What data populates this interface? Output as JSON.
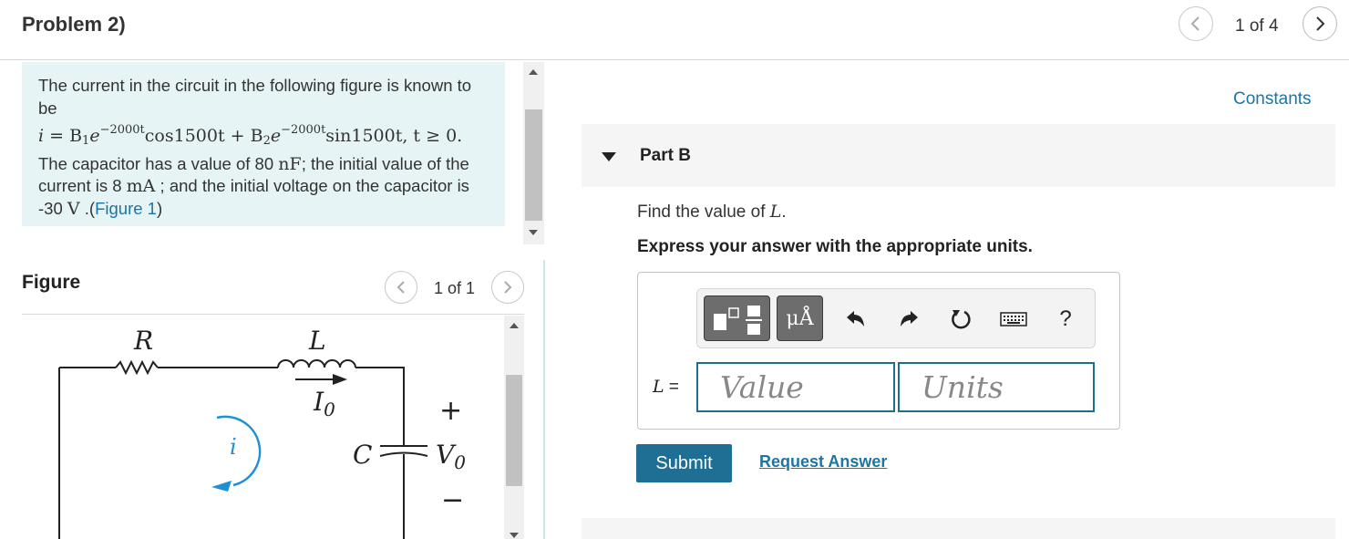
{
  "header": {
    "title": "Problem 2)",
    "pager": "1 of 4"
  },
  "intro": {
    "line1": "The current in the circuit in the following figure is known to be",
    "eq_i": "i",
    "eq_eq": " = B",
    "eq_b1sub": "1",
    "eq_e": "e",
    "eq_exp1": "−2000t",
    "eq_cos": "cos1500t + B",
    "eq_b2sub": "2",
    "eq_e2": "e",
    "eq_exp2": "−2000t",
    "eq_sin": "sin1500t, t ≥ 0.",
    "text2a": "The capacitor has a value of 80 ",
    "unit_nf": "nF",
    "text2b": "; the initial value of the current is 8 ",
    "unit_ma": "mA",
    "text2c": " ; and the initial voltage on the capacitor is -30 ",
    "unit_v": "V",
    "text2d": " .(",
    "figure_link": "Figure 1",
    "text2e": ")"
  },
  "figure": {
    "label": "Figure",
    "pager": "1 of 1",
    "circuit": {
      "R": "R",
      "L": "L",
      "I0_main": "I",
      "I0_sub": "0",
      "i": "i",
      "C": "C",
      "V0_main": "V",
      "V0_sub": "0",
      "plus": "+",
      "minus": "−"
    }
  },
  "right": {
    "constants": "Constants",
    "part_title": "Part B",
    "question_prefix": "Find the value of ",
    "question_var": "L",
    "question_suffix": ".",
    "instruction": "Express your answer with the appropriate units.",
    "lhs_var": "L",
    "lhs_eq": " =",
    "value_placeholder": "Value",
    "units_placeholder": "Units",
    "toolbar_units_label": "μÅ",
    "help_label": "?",
    "submit": "Submit",
    "request_answer": "Request Answer"
  },
  "icons": {
    "prev": "chevron-left-icon",
    "next": "chevron-right-icon",
    "templates": "templates-icon",
    "units": "units-icon",
    "undo": "undo-icon",
    "redo": "redo-icon",
    "reset": "reset-icon",
    "keyboard": "keyboard-icon",
    "help": "help-icon"
  },
  "colors": {
    "link": "#1b75a6",
    "submit_bg": "#1e6f93",
    "intro_bg": "#e6f4f5",
    "input_border": "#1c6e8c",
    "circuit_arrow": "#1e90d6"
  }
}
